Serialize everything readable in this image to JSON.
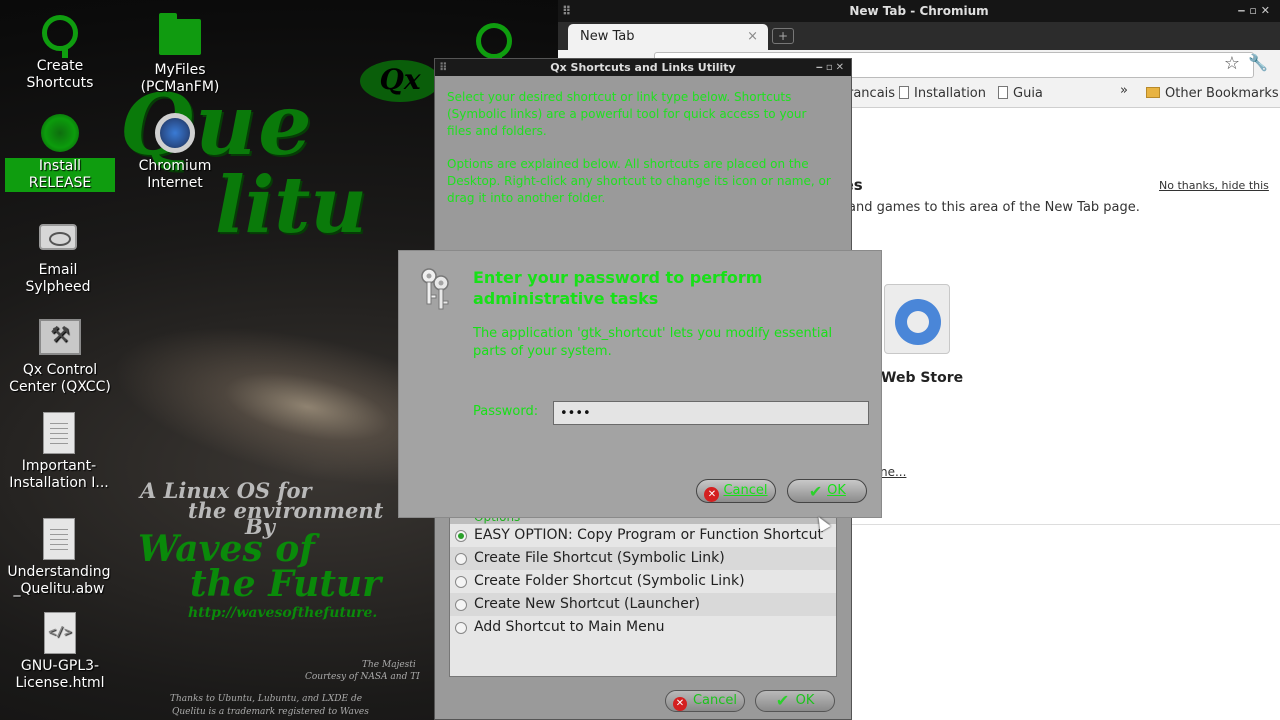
{
  "desktop": {
    "wallpaper": {
      "title_line1": "Que",
      "title_line2": "litu",
      "badge": "Qx",
      "tagline1": "A Linux OS for",
      "tagline2": "the environment",
      "by": "By",
      "waves1": "Waves of",
      "waves2": "the Futur",
      "url": "http://wavesofthefuture.",
      "credit1": "The Majesti",
      "credit2": "Courtesy of NASA and TI",
      "credit3": "Thanks to Ubuntu, Lubuntu, and LXDE de",
      "credit4": "Quelitu is a trademark registered to Waves"
    },
    "icons": [
      {
        "label": "Create Shortcuts",
        "icon": "qx-logo-icon"
      },
      {
        "label": "Install RELEASE",
        "icon": "install-disc-icon"
      },
      {
        "label": "Email Sylpheed",
        "icon": "mail-icon"
      },
      {
        "label": "Qx Control Center (QXCC)",
        "icon": "tools-icon"
      },
      {
        "label": "Important-Installation I...",
        "icon": "document-icon"
      },
      {
        "label": "Understanding _Quelitu.abw",
        "icon": "document-icon"
      },
      {
        "label": "GNU-GPL3-License.html",
        "icon": "code-file-icon"
      },
      {
        "label": "MyFiles (PCManFM)",
        "icon": "folder-icon"
      },
      {
        "label": "Chromium Internet",
        "icon": "chromium-icon"
      }
    ]
  },
  "chromium": {
    "window_title": "New Tab - Chromium",
    "tab_label": "New Tab",
    "tab_close": "×",
    "new_tab_button": "+",
    "bookmarks": [
      "rancais",
      "Installation",
      "Guia"
    ],
    "bookmarks_overflow": "»",
    "other_bookmarks": "Other Bookmarks",
    "ntp_heading": "mes",
    "ntp_dismiss": "No thanks, hide this",
    "ntp_description": "and games to this area of the New Tab page.",
    "web_store_label": "Web Store",
    "ntp_more_link": "ne..."
  },
  "qx_window": {
    "title": "Qx Shortcuts and Links Utility",
    "info_paragraph1": "Select your desired shortcut or link type below. Shortcuts (Symbolic links) are a powerful tool for quick access to your files and folders.",
    "info_paragraph2": "Options are explained below. All shortcuts are placed on the Desktop. Right-click any shortcut to change its icon or name, or drag it into another folder.",
    "list_header": "Options",
    "options": [
      {
        "label": "EASY OPTION: Copy Program or Function Shortcut",
        "selected": true
      },
      {
        "label": "Create File Shortcut (Symbolic Link)",
        "selected": false
      },
      {
        "label": "Create Folder Shortcut (Symbolic Link)",
        "selected": false
      },
      {
        "label": "Create New Shortcut (Launcher)",
        "selected": false
      },
      {
        "label": "Add Shortcut to Main Menu",
        "selected": false
      }
    ],
    "cancel_label": "Cancel",
    "ok_label": "OK"
  },
  "password_dialog": {
    "heading": "Enter your password to perform administrative tasks",
    "description": "The application 'gtk_shortcut' lets you modify essential parts of your system.",
    "password_label": "Password:",
    "password_value": "••••",
    "cancel_label": "Cancel",
    "ok_label": "OK"
  },
  "colors": {
    "accent_green": "#18e018",
    "dialog_gray": "#a3a3a3",
    "selected_label": "#0f9d0f"
  }
}
